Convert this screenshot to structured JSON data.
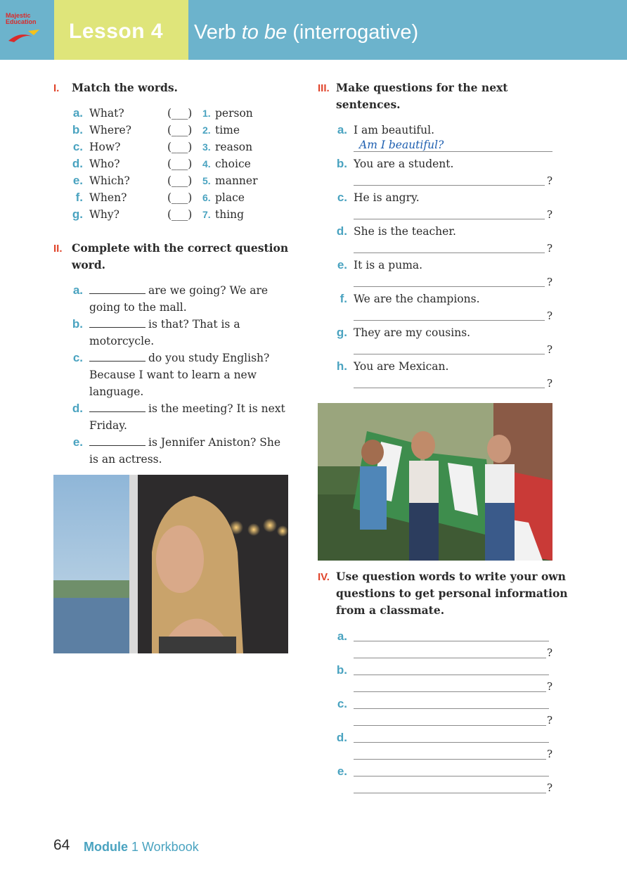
{
  "header": {
    "logo_line1": "Majestic",
    "logo_line2": "Education",
    "lesson_label": "Lesson 4",
    "title_part1": "Verb ",
    "title_italic": "to be",
    "title_part2": " (interrogative)"
  },
  "section1": {
    "num": "I.",
    "title": "Match the words.",
    "items": [
      {
        "letter": "a.",
        "word": "What?",
        "paren": "(___)",
        "num": "1.",
        "meaning": "person"
      },
      {
        "letter": "b.",
        "word": "Where?",
        "paren": "(___)",
        "num": "2.",
        "meaning": "time"
      },
      {
        "letter": "c.",
        "word": "How?",
        "paren": "(___)",
        "num": "3.",
        "meaning": "reason"
      },
      {
        "letter": "d.",
        "word": "Who?",
        "paren": "(___)",
        "num": "4.",
        "meaning": "choice"
      },
      {
        "letter": "e.",
        "word": "Which?",
        "paren": "(___)",
        "num": "5.",
        "meaning": "manner"
      },
      {
        "letter": "f.",
        "word": "When?",
        "paren": "(___)",
        "num": "6.",
        "meaning": "place"
      },
      {
        "letter": "g.",
        "word": "Why?",
        "paren": "(___)",
        "num": "7.",
        "meaning": "thing"
      }
    ]
  },
  "section2": {
    "num": "II.",
    "title_line1": "Complete with the correct question",
    "title_line2": "word.",
    "items": [
      {
        "letter": "a.",
        "line1": "are we going? We are",
        "line2": "going to the mall."
      },
      {
        "letter": "b.",
        "line1": "is that? That is a",
        "line2": "motorcycle."
      },
      {
        "letter": "c.",
        "line1": "do you study English?",
        "line2": "Because I want to learn a new",
        "line3": "language."
      },
      {
        "letter": "d.",
        "line1": "is the meeting? It is next",
        "line2": "Friday."
      },
      {
        "letter": "e.",
        "line1": "is Jennifer Aniston? She",
        "line2": "is an actress."
      }
    ]
  },
  "section3": {
    "num": "III.",
    "title_line1": "Make questions for the next",
    "title_line2": "sentences.",
    "example_answer": "Am I beautiful?",
    "qmark": "?",
    "items": [
      {
        "letter": "a.",
        "sentence": "I am beautiful."
      },
      {
        "letter": "b.",
        "sentence": "You are a student."
      },
      {
        "letter": "c.",
        "sentence": "He is angry."
      },
      {
        "letter": "d.",
        "sentence": "She is the teacher."
      },
      {
        "letter": "e.",
        "sentence": "It is a puma."
      },
      {
        "letter": "f.",
        "sentence": "We are the champions."
      },
      {
        "letter": "g.",
        "sentence": "They are my cousins."
      },
      {
        "letter": "h.",
        "sentence": "You are Mexican."
      }
    ]
  },
  "section4": {
    "num": "IV.",
    "title_line1": "Use question words to write your own",
    "title_line2": "questions to get personal information",
    "title_line3": "from a classmate.",
    "qmark": "?",
    "letters": [
      "a.",
      "b.",
      "c.",
      "d.",
      "e."
    ]
  },
  "footer": {
    "page_number": "64",
    "module_bold": "Module",
    "module_rest": " 1 Workbook"
  }
}
